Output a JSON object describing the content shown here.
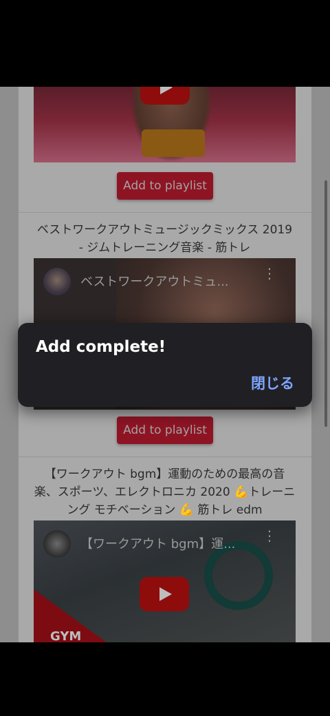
{
  "feed": {
    "items": [
      {
        "add_label": "Add to playlist"
      },
      {
        "title": "ベストワークアウトミュージックミックス 2019 - ジムトレーニング音楽 - 筋トレ",
        "video_title": "ベストワークアウトミュ...",
        "add_label": "Add to playlist"
      },
      {
        "title": "【ワークアウト bgm】運動のための最高の音楽、スポーツ、エレクトロニカ 2020 💪トレーニング モチベーション 💪 筋トレ edm",
        "video_title": "【ワークアウト bgm】運...",
        "thumb_text": "GYM"
      }
    ]
  },
  "dialog": {
    "message": "Add complete!",
    "close_label": "閉じる"
  },
  "icons": {
    "play": "play-icon",
    "more": "more-vertical-icon",
    "avatar": "channel-avatar"
  },
  "colors": {
    "button_bg": "#8e1424",
    "dialog_bg": "#201f23",
    "dialog_action": "#7ea6ff"
  }
}
